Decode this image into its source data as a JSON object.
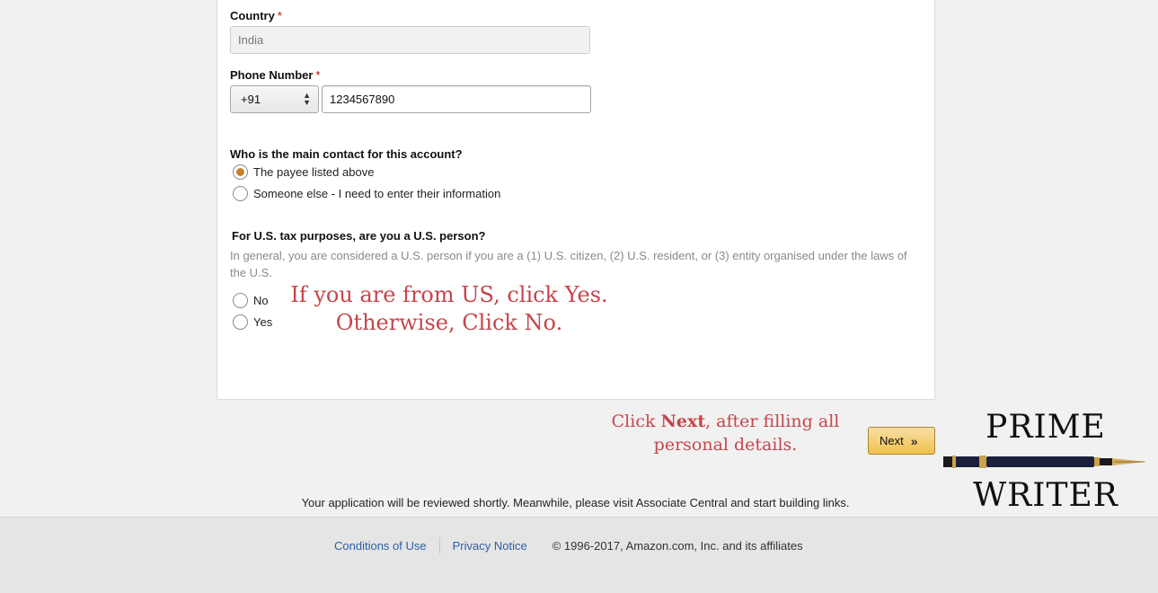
{
  "form": {
    "country_label": "Country",
    "required_mark": "*",
    "country_value": "India",
    "phone_label": "Phone Number",
    "phone_code": "+91",
    "phone_value": "1234567890",
    "contact_question": "Who is the main contact for this account?",
    "contact_options": [
      {
        "label": "The payee listed above",
        "checked": true
      },
      {
        "label": "Someone else - I need to enter their information",
        "checked": false
      }
    ],
    "tax_question": "For U.S. tax purposes, are you a U.S. person?",
    "tax_hint": "In general, you are considered a U.S. person if you are a (1) U.S. citizen, (2) U.S. resident, or (3) entity organised under the laws of the U.S.",
    "tax_options": [
      {
        "label": "No",
        "checked": false
      },
      {
        "label": "Yes",
        "checked": false
      }
    ]
  },
  "annotations": {
    "us_line1": "If you are from US, click Yes.",
    "us_line2": "Otherwise, Click No.",
    "next_pre": "Click ",
    "next_bold": "Next",
    "next_post": ", after filling all personal details."
  },
  "next_button": {
    "label": "Next",
    "icon": "double-chevron-right-icon"
  },
  "logo": {
    "line1": "PRIME",
    "line2": "WRITER",
    "icon": "fountain-pen-icon"
  },
  "review_message": "Your application will be reviewed shortly. Meanwhile, please visit Associate Central and start building links.",
  "footer": {
    "conditions": "Conditions of Use",
    "privacy": "Privacy Notice",
    "copyright": "© 1996-2017, Amazon.com, Inc. and its affiliates"
  },
  "colors": {
    "accent_radio": "#c5802c",
    "annotation": "#c6454a",
    "link": "#2d5fa4",
    "button_bg": "#f0c14b"
  }
}
